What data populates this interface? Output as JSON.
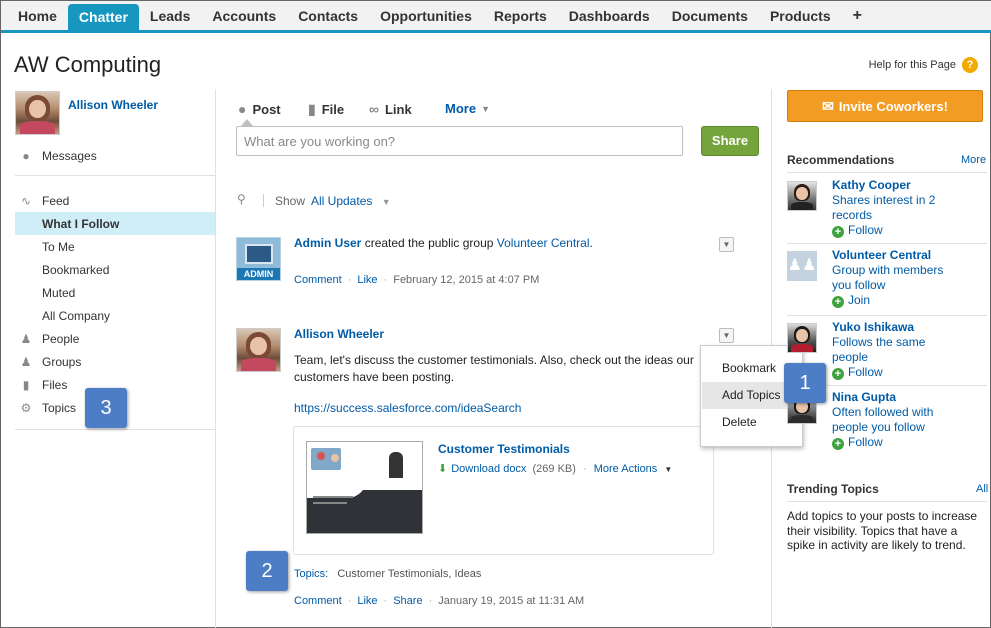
{
  "nav": {
    "tabs": [
      "Home",
      "Chatter",
      "Leads",
      "Accounts",
      "Contacts",
      "Opportunities",
      "Reports",
      "Dashboards",
      "Documents",
      "Products",
      "+"
    ],
    "active_index": 1
  },
  "page": {
    "title": "AW Computing",
    "help_label": "Help for this Page",
    "help_icon": "?"
  },
  "sidebar": {
    "user_name": "Allison Wheeler",
    "messages_label": "Messages",
    "feed_label": "Feed",
    "feed_items": [
      "What I Follow",
      "To Me",
      "Bookmarked",
      "Muted",
      "All Company"
    ],
    "people_label": "People",
    "groups_label": "Groups",
    "files_label": "Files",
    "topics_label": "Topics"
  },
  "publisher": {
    "post_label": "Post",
    "file_label": "File",
    "link_label": "Link",
    "more_label": "More",
    "placeholder": "What are you working on?",
    "share_label": "Share"
  },
  "filter": {
    "show_label": "Show",
    "value": "All Updates"
  },
  "posts": [
    {
      "author": "Admin User",
      "text_mid": " created the public group ",
      "group": "Volunteer Central",
      "text_end": ".",
      "avatar_label": "ADMIN",
      "comment": "Comment",
      "like": "Like",
      "timestamp": "February 12, 2015 at 4:07 PM"
    },
    {
      "author": "Allison Wheeler",
      "body_line1": "Team, let's discuss the customer testimonials. Also, check out the ideas our",
      "body_line2": "customers have been posting.",
      "link": "https://success.salesforce.com/ideaSearch",
      "attachment_title": "Customer Testimonials",
      "download_label": "Download docx",
      "file_size": "(269 KB)",
      "more_actions": "More Actions",
      "topics_label": "Topics:",
      "topics_value": "Customer Testimonials, Ideas",
      "comment": "Comment",
      "like": "Like",
      "share": "Share",
      "timestamp": "January 19, 2015 at 11:31 AM"
    }
  ],
  "post_menu": {
    "items": [
      "Bookmark",
      "Add Topics",
      "Delete"
    ],
    "hover_index": 1
  },
  "callouts": [
    "1",
    "2",
    "3"
  ],
  "right": {
    "invite_label": "Invite Coworkers!",
    "recommendations_label": "Recommendations",
    "more_label": "More",
    "recommendations": [
      {
        "name": "Kathy Cooper",
        "desc1": "Shares interest in 2",
        "desc2": "records",
        "action": "Follow"
      },
      {
        "name": "Volunteer Central",
        "desc1": "Group with members",
        "desc2": "you follow",
        "action": "Join"
      },
      {
        "name": "Yuko Ishikawa",
        "desc1": "Follows the same",
        "desc2": "people",
        "action": "Follow"
      },
      {
        "name": "Nina Gupta",
        "desc1": "Often followed with",
        "desc2": "people you follow",
        "action": "Follow"
      }
    ],
    "trending_label": "Trending Topics",
    "all_label": "All",
    "trending_text1": "Add topics to your posts to increase",
    "trending_text2": "their visibility. Topics that have a",
    "trending_text3": "spike in activity are likely to trend."
  }
}
